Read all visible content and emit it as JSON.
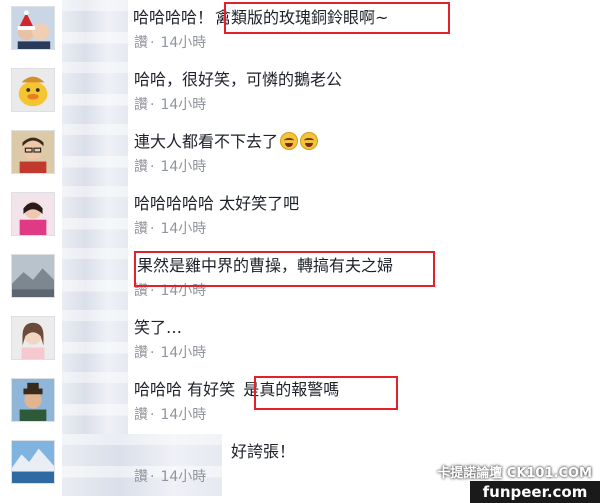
{
  "comments": [
    {
      "text_a": "哈哈哈哈！",
      "text_b": "禽類版的玫瑰銅鈴眼啊~",
      "meta_prefix": "讚",
      "time": "14小時",
      "avatar": "avatar-christmas-couple"
    },
    {
      "text_a": "哈哈，很好笑，可憐的鵝老公",
      "meta_prefix": "讚",
      "time": "14小時",
      "avatar": "avatar-cartoon-duck"
    },
    {
      "text_a": "連大人都看不下去了",
      "meta_prefix": "讚",
      "time": "14小時",
      "avatar": "avatar-man-glasses",
      "emoji": "laughing-tears-icon"
    },
    {
      "text_a": "哈哈哈哈哈 太好笑了吧",
      "meta_prefix": "讚",
      "time": "14小時",
      "avatar": "avatar-pink-figure"
    },
    {
      "text_b": "果然是雞中界的曹操，轉搞有夫之婦",
      "meta_prefix": "讚",
      "time": "14小時",
      "avatar": "avatar-landscape-gray"
    },
    {
      "text_a": "笑了…",
      "meta_prefix": "讚",
      "time": "14小時",
      "avatar": "avatar-woman"
    },
    {
      "text_a": "哈哈哈 有好笑 ",
      "text_b": "是真的報警嗎",
      "meta_prefix": "讚",
      "time": "14小時",
      "avatar": "avatar-man-hat"
    },
    {
      "text_a": "好誇張！",
      "meta_prefix": "讚",
      "time": "14小時",
      "avatar": "avatar-mountain-lake"
    }
  ],
  "watermark": {
    "line1": "卡提諾論壇 CK101.COM",
    "line2": "funpeer.com"
  },
  "colors": {
    "highlight": "#e3202c",
    "meta": "#90949c",
    "text": "#1d2129"
  }
}
